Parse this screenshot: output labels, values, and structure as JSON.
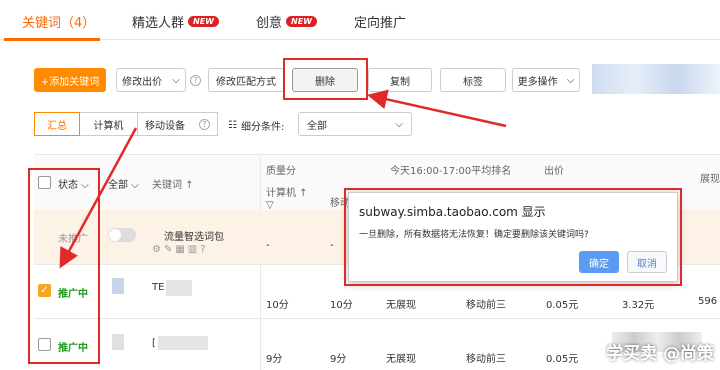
{
  "tabs": [
    {
      "label": "关键词（4）"
    },
    {
      "label": "精选人群",
      "badge": "NEW"
    },
    {
      "label": "创意",
      "badge": "NEW"
    },
    {
      "label": "定向推广"
    }
  ],
  "toolbar": {
    "add_keyword": "+添加关键词",
    "modify_bid": "修改出价",
    "modify_match": "修改匹配方式",
    "delete": "删除",
    "copy": "复制",
    "tag": "标签",
    "more": "更多操作"
  },
  "filters": {
    "seg_summary": "汇总",
    "seg_computer": "计算机",
    "seg_mobile": "移动设备",
    "breakdown_label": "细分条件:",
    "breakdown_value": "全部"
  },
  "table": {
    "headers": {
      "status": "状态",
      "all": "全部",
      "keyword": "关键词",
      "quality": "质量分",
      "quality_pc": "计算机",
      "quality_mobile": "移动",
      "rank": "今天16:00-17:00平均排名",
      "bid": "出价",
      "more": "展现"
    },
    "rows": [
      {
        "status": "未推广",
        "keyword": "流量智选词包",
        "quality_pc": "-",
        "quality_mobile": "-",
        "rank_pc": "",
        "rank_mobile": "",
        "bid_pc": "",
        "bid_mobile": "",
        "extra": ""
      },
      {
        "status": "推广中",
        "keyword": "TE",
        "quality_pc": "10分",
        "quality_mobile": "10分",
        "rank_pc": "无展现",
        "rank_mobile": "移动前三",
        "bid_pc": "0.05元",
        "bid_mobile": "3.32元",
        "extra": "596"
      },
      {
        "status": "推广中",
        "keyword": "[",
        "quality_pc": "9分",
        "quality_mobile": "9分",
        "rank_pc": "无展现",
        "rank_mobile": "移动前三",
        "bid_pc": "0.05元",
        "bid_mobile": "",
        "extra": ""
      }
    ]
  },
  "dialog": {
    "title": "subway.simba.taobao.com 显示",
    "message": "一旦删除，所有数据将无法恢复！确定要删除该关键词吗?",
    "confirm": "确定",
    "cancel": "取消"
  },
  "watermark": "学买卖 @尚策",
  "colors": {
    "accent": "#ff6a00",
    "annotation_red": "#e02a2a",
    "confirm_blue": "#5b9cf0",
    "status_green": "#1a9b1a"
  }
}
